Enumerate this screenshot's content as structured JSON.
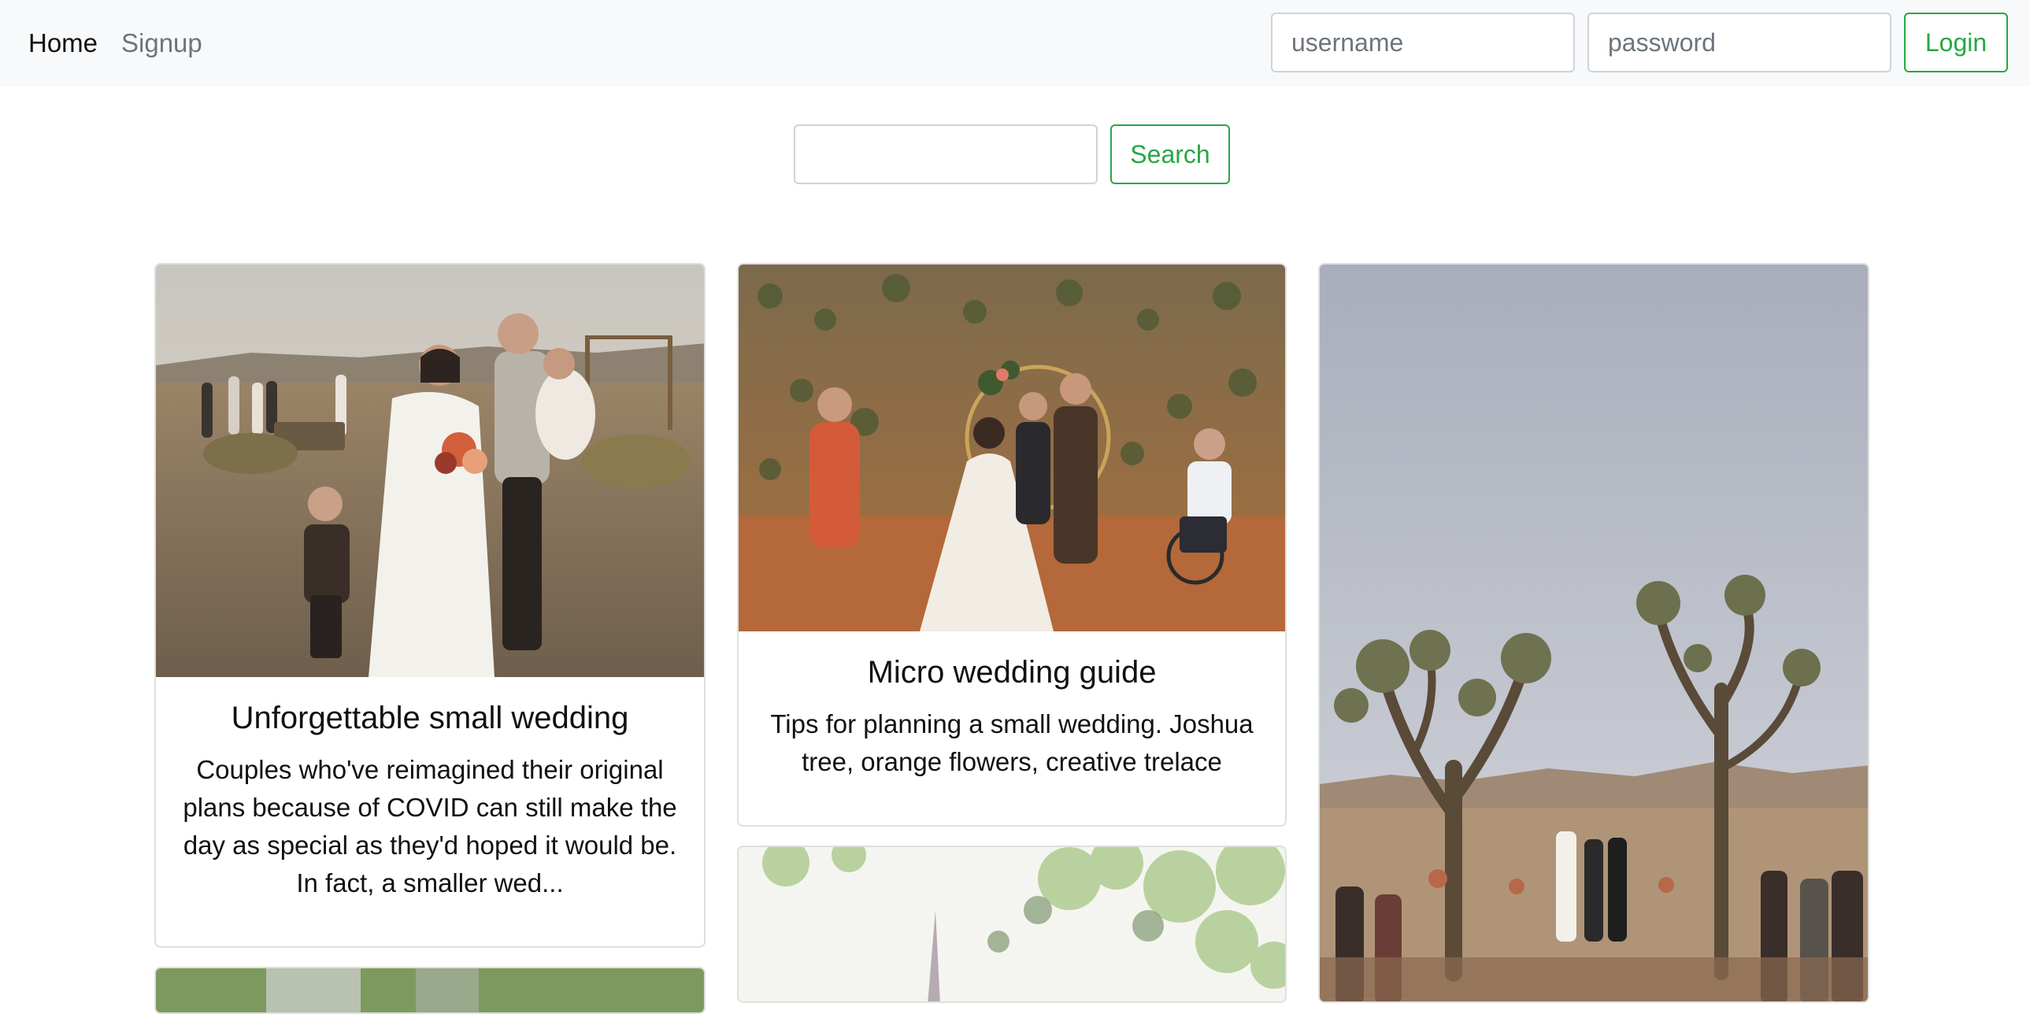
{
  "nav": {
    "home_label": "Home",
    "signup_label": "Signup",
    "username_placeholder": "username",
    "password_placeholder": "password",
    "login_label": "Login"
  },
  "search": {
    "value": "",
    "button_label": "Search"
  },
  "colors": {
    "accent": "#28a745",
    "navbar_bg": "#f8f9fa",
    "muted_link": "#6c757d"
  },
  "cards": [
    {
      "title": "Unforgettable small wedding",
      "text": "Couples who've reimagined their original plans because of COVID can still make the day as special as they'd hoped it would be. In fact, a smaller wed...",
      "image": "desert-wedding-family-photo"
    },
    {
      "title": "Micro wedding guide",
      "text": "Tips for planning a small wedding. Joshua tree, orange flowers, creative trelace",
      "image": "desert-ceremony-arch-photo"
    },
    {
      "image": "joshua-tree-ceremony-photo"
    },
    {
      "image": "greenery-floral-photo"
    },
    {
      "image": "greenery-partial-photo"
    }
  ]
}
